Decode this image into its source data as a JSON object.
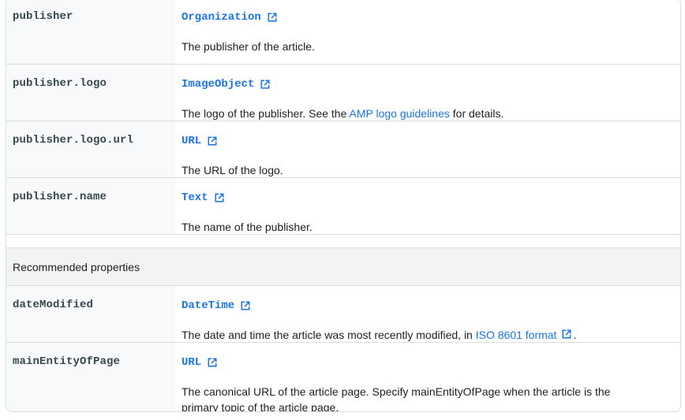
{
  "required_rows": [
    {
      "property": "publisher",
      "type": "Organization",
      "description": "The publisher of the article."
    },
    {
      "property": "publisher.logo",
      "type": "ImageObject",
      "description_before": "The logo of the publisher. See the ",
      "description_link": "AMP logo guidelines",
      "description_after": " for details."
    },
    {
      "property": "publisher.logo.url",
      "type": "URL",
      "description": "The URL of the logo."
    },
    {
      "property": "publisher.name",
      "type": "Text",
      "description": "The name of the publisher."
    }
  ],
  "recommended_section": {
    "heading": "Recommended properties"
  },
  "recommended_rows": [
    {
      "property": "dateModified",
      "type": "DateTime",
      "description_before": "The date and time the article was most recently modified, in ",
      "description_link": "ISO 8601 format",
      "description_after": "."
    },
    {
      "property": "mainEntityOfPage",
      "type": "URL",
      "description": "The canonical URL of the article page. Specify mainEntityOfPage when the article is the primary topic of the article page."
    }
  ],
  "icons": {
    "external_link": "open-in-new-icon"
  },
  "colors": {
    "link": "#1a73e8",
    "property_text": "#37474f",
    "property_bg": "#f8f9fa",
    "section_bg": "#f1f3f4",
    "border": "#dadce0"
  }
}
